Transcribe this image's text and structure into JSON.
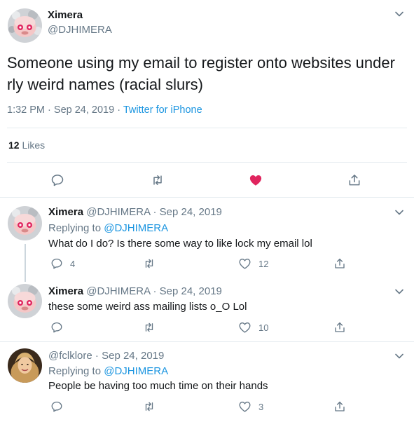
{
  "main_tweet": {
    "author_name": "Ximera",
    "author_handle": "@DJHIMERA",
    "text": "Someone using my email to register onto websites under rly weird names (racial slurs)",
    "time": "1:32 PM",
    "separator": "·",
    "date": "Sep 24, 2019",
    "source": "Twitter for iPhone",
    "likes_count": "12",
    "likes_label": "Likes",
    "liked": true,
    "like_color": "#e0245e"
  },
  "replies": [
    {
      "author_name": "Ximera",
      "author_handle": "@DJHIMERA",
      "date": "Sep 24, 2019",
      "replying_label": "Replying to",
      "replying_to": "@DJHIMERA",
      "text": "What do I do? Is there some way to like lock my email lol",
      "reply_count": "4",
      "like_count": "12"
    },
    {
      "author_name": "Ximera",
      "author_handle": "@DJHIMERA",
      "date": "Sep 24, 2019",
      "text": "these some weird ass mailing lists o_O Lol",
      "like_count": "10"
    },
    {
      "author_name": "",
      "author_handle": "@fclklore",
      "date": "Sep 24, 2019",
      "replying_label": "Replying to",
      "replying_to": "@DJHIMERA",
      "text": "People be having too much time on their hands",
      "like_count": "3"
    }
  ],
  "colors": {
    "link": "#1b95e0",
    "muted": "#657786",
    "text": "#14171a",
    "divider": "#e6ecf0"
  },
  "icons": [
    "reply-icon",
    "retweet-icon",
    "like-icon",
    "share-icon",
    "chevron-down-icon"
  ]
}
